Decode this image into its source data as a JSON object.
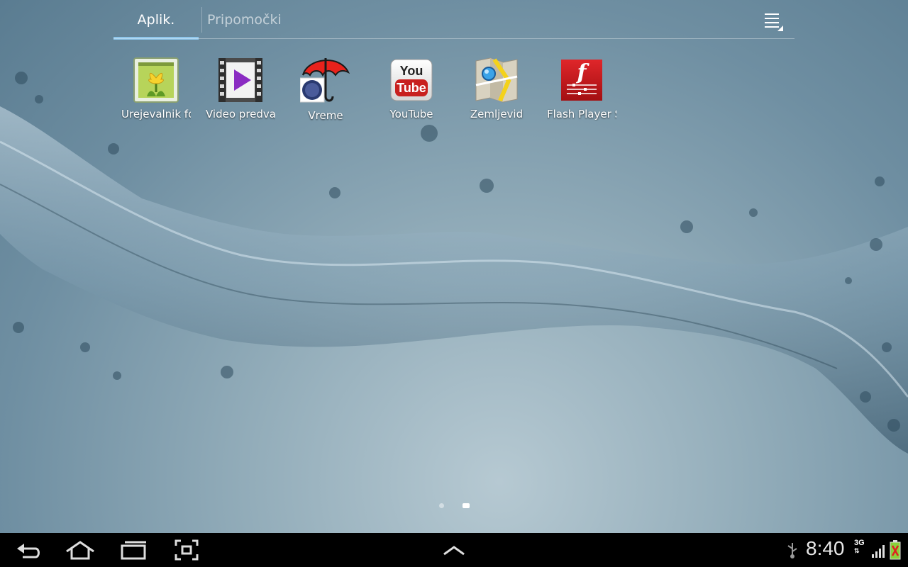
{
  "tabs": [
    {
      "label": "Aplik.",
      "active": true
    },
    {
      "label": "Pripomočki",
      "active": false
    }
  ],
  "apps": [
    {
      "label": "Urejevalnik fo",
      "icon": "photo-editor-icon"
    },
    {
      "label": "Video predvaj",
      "icon": "video-player-icon"
    },
    {
      "label": "Vreme",
      "icon": "weather-umbrella-icon"
    },
    {
      "label": "YouTube",
      "icon": "youtube-icon"
    },
    {
      "label": "Zemljevid",
      "icon": "maps-icon"
    },
    {
      "label": "Flash Player S",
      "icon": "flash-player-icon"
    }
  ],
  "youtube_logo": {
    "top": "You",
    "bottom": "Tube"
  },
  "flash_logo": "f",
  "page_indicator": {
    "pages": 2,
    "current": 2
  },
  "status": {
    "time": "8:40",
    "network": "3G",
    "usb": "usb-icon",
    "signal": "signal-bars-icon",
    "battery": "battery-charging-icon"
  },
  "colors": {
    "tab_underline": "#8fc6ea",
    "youtube_red": "#c8201e",
    "flash_red": "#c0161a"
  }
}
